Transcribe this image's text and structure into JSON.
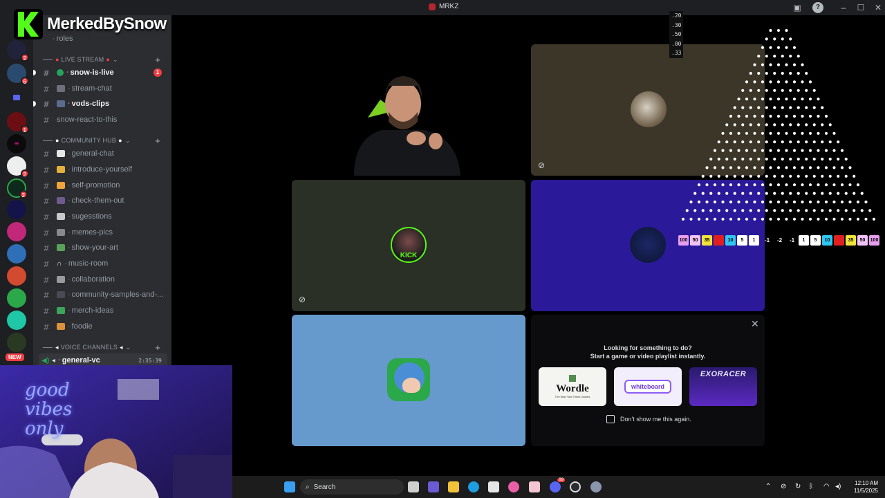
{
  "window": {
    "title": "MRKZ"
  },
  "brand": {
    "name": "MerkedBySnow"
  },
  "rail": {
    "new_label": "NEW",
    "servers": [
      {
        "badge": "2"
      },
      {
        "badge": "6"
      },
      {
        "badge": ""
      },
      {
        "badge": "1"
      },
      {
        "badge": ""
      },
      {
        "badge": "2"
      },
      {
        "badge": "2"
      },
      {
        "badge": ""
      },
      {
        "badge": ""
      },
      {
        "badge": ""
      },
      {
        "badge": ""
      },
      {
        "badge": ""
      },
      {
        "badge": ""
      },
      {
        "badge": ""
      }
    ]
  },
  "channels": {
    "top_partial": "roles",
    "categories": {
      "live": "LIVE STREAM",
      "community": "COMMUNITY HUB",
      "voice": "VOICE CHANNELS"
    },
    "live": [
      {
        "name": "snow-is-live",
        "ping": "1"
      },
      {
        "name": "stream-chat"
      },
      {
        "name": "vods-clips"
      },
      {
        "name": "snow-react-to-this"
      }
    ],
    "community": [
      "general-chat",
      "introduce-yourself",
      "self-promotion",
      "check-them-out",
      "sugesstions",
      "memes-pics",
      "show-your-art",
      "music-room",
      "collaboration",
      "community-samples-and-...",
      "merch-ideas",
      "foodie"
    ],
    "voice": {
      "name": "general-vc",
      "time": "2:35:39"
    }
  },
  "activity": {
    "line1": "Looking for something to do?",
    "line2": "Start a game or video playlist instantly.",
    "cards": [
      {
        "title": "Wordle",
        "sub": "The New York Times Games"
      },
      {
        "title": "whiteboard",
        "sub": "Whiteboard"
      },
      {
        "title": "EXORACER",
        "sub": ""
      }
    ],
    "dont_show": "Don't show me this again."
  },
  "tiles": {
    "kick_label": "KICK"
  },
  "plinko": {
    "odds": [
      ".20",
      ".30",
      ".50",
      ".00",
      ".33"
    ],
    "left_slots": [
      "100",
      "50",
      "35",
      "",
      "10",
      "5",
      "1"
    ],
    "negatives": [
      "-1",
      "-2",
      "-1"
    ],
    "right_slots": [
      "1",
      "5",
      "10",
      "",
      "35",
      "50",
      "100"
    ]
  },
  "facecam": {
    "neon": "good vibes only"
  },
  "taskbar": {
    "search": "Search",
    "time": "12:10 AM",
    "date": "11/5/2025",
    "discord_badge": "99"
  },
  "colors": {
    "accent_green": "#53fc18",
    "discord_red": "#f23f43",
    "tile_olive": "#2b3026",
    "tile_purple": "#2a1a99",
    "tile_blue": "#6699cc",
    "tile_brown": "#3b3628"
  }
}
